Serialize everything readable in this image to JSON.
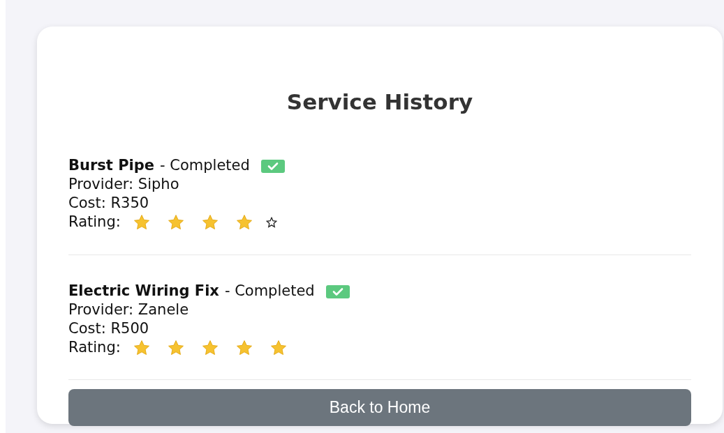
{
  "title": "Service History",
  "services": [
    {
      "name": "Burst Pipe",
      "status": "- Completed",
      "completed": true,
      "provider": "Provider: Sipho",
      "cost": "Cost: R350",
      "rating_label": "Rating:",
      "stars": 4
    },
    {
      "name": "Electric Wiring Fix",
      "status": "- Completed",
      "completed": true,
      "provider": "Provider: Zanele",
      "cost": "Cost: R500",
      "rating_label": "Rating:",
      "stars": 5
    }
  ],
  "button": "Back to Home"
}
